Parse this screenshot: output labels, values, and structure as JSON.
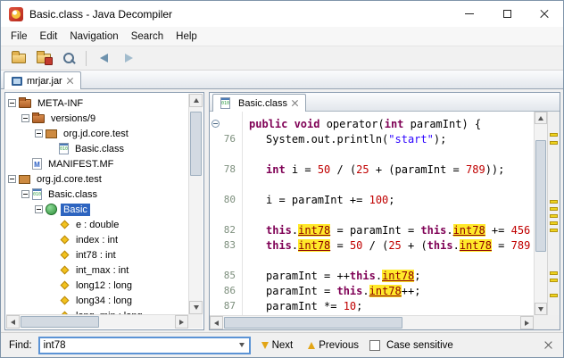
{
  "window": {
    "title": "Basic.class - Java Decompiler"
  },
  "menu": {
    "items": [
      "File",
      "Edit",
      "Navigation",
      "Search",
      "Help"
    ]
  },
  "toolbar": {
    "items": [
      {
        "name": "open-file-button",
        "icon": "folder-open"
      },
      {
        "name": "open-jar-button",
        "icon": "folder-jar"
      },
      {
        "name": "search-button",
        "icon": "search"
      },
      {
        "separator": true
      },
      {
        "name": "back-button",
        "icon": "arrow-left"
      },
      {
        "name": "forward-button",
        "icon": "arrow-right"
      }
    ]
  },
  "document_tabs": [
    {
      "label": "mrjar.jar",
      "icon": "jar",
      "selected": true
    }
  ],
  "tree": {
    "items": [
      {
        "label": "META-INF",
        "level": 0,
        "exp": "minus",
        "icon": "folder"
      },
      {
        "label": "versions/9",
        "level": 1,
        "exp": "minus",
        "icon": "folder"
      },
      {
        "label": "org.jd.core.test",
        "level": 2,
        "exp": "minus",
        "icon": "package"
      },
      {
        "label": "Basic.class",
        "level": 3,
        "exp": "none",
        "icon": "classfile"
      },
      {
        "label": "MANIFEST.MF",
        "level": 1,
        "exp": "none",
        "icon": "manifest"
      },
      {
        "label": "org.jd.core.test",
        "level": 0,
        "exp": "minus",
        "icon": "package"
      },
      {
        "label": "Basic.class",
        "level": 1,
        "exp": "minus",
        "icon": "classfile"
      },
      {
        "label": "Basic",
        "level": 2,
        "exp": "minus",
        "icon": "class",
        "selected": true
      },
      {
        "label": "e : double",
        "level": 3,
        "exp": "none",
        "icon": "field"
      },
      {
        "label": "index : int",
        "level": 3,
        "exp": "none",
        "icon": "field"
      },
      {
        "label": "int78 : int",
        "level": 3,
        "exp": "none",
        "icon": "field"
      },
      {
        "label": "int_max : int",
        "level": 3,
        "exp": "none",
        "icon": "field"
      },
      {
        "label": "long12 : long",
        "level": 3,
        "exp": "none",
        "icon": "field"
      },
      {
        "label": "long34 : long",
        "level": 3,
        "exp": "none",
        "icon": "field"
      },
      {
        "label": "long_min : long",
        "level": 3,
        "exp": "none",
        "icon": "field"
      }
    ]
  },
  "editor": {
    "tab": {
      "label": "Basic.class",
      "icon": "classfile"
    },
    "lines": [
      {
        "num": "",
        "fold": true,
        "indent": 1,
        "tokens": [
          [
            "kw",
            "public void "
          ],
          [
            "pl",
            "operator("
          ],
          [
            "kw",
            "int"
          ],
          [
            "pl",
            " paramInt) {"
          ]
        ]
      },
      {
        "num": "76",
        "fold": false,
        "indent": 2,
        "tokens": [
          [
            "pl",
            "System.out.println("
          ],
          [
            "str",
            "\"start\""
          ],
          [
            "pl",
            ");"
          ]
        ]
      },
      {
        "num": "",
        "fold": false,
        "indent": 0,
        "tokens": []
      },
      {
        "num": "78",
        "fold": false,
        "indent": 2,
        "tokens": [
          [
            "kw",
            "int"
          ],
          [
            "pl",
            " i = "
          ],
          [
            "num",
            "50"
          ],
          [
            "pl",
            " / ("
          ],
          [
            "num",
            "25"
          ],
          [
            "pl",
            " + (paramInt = "
          ],
          [
            "num",
            "789"
          ],
          [
            "pl",
            "));"
          ]
        ]
      },
      {
        "num": "",
        "fold": false,
        "indent": 0,
        "tokens": []
      },
      {
        "num": "80",
        "fold": false,
        "indent": 2,
        "tokens": [
          [
            "pl",
            "i = paramInt += "
          ],
          [
            "num",
            "100"
          ],
          [
            "pl",
            ";"
          ]
        ]
      },
      {
        "num": "",
        "fold": false,
        "indent": 0,
        "tokens": []
      },
      {
        "num": "82",
        "fold": false,
        "indent": 2,
        "tokens": [
          [
            "kw",
            "this"
          ],
          [
            "pl",
            "."
          ],
          [
            "fh",
            "int78"
          ],
          [
            "pl",
            " = paramInt = "
          ],
          [
            "kw",
            "this"
          ],
          [
            "pl",
            "."
          ],
          [
            "fh",
            "int78"
          ],
          [
            "pl",
            " += "
          ],
          [
            "num",
            "456"
          ]
        ]
      },
      {
        "num": "83",
        "fold": false,
        "indent": 2,
        "tokens": [
          [
            "kw",
            "this"
          ],
          [
            "pl",
            "."
          ],
          [
            "fh",
            "int78"
          ],
          [
            "pl",
            " = "
          ],
          [
            "num",
            "50"
          ],
          [
            "pl",
            " / ("
          ],
          [
            "num",
            "25"
          ],
          [
            "pl",
            " + ("
          ],
          [
            "kw",
            "this"
          ],
          [
            "pl",
            "."
          ],
          [
            "fh",
            "int78"
          ],
          [
            "pl",
            " = "
          ],
          [
            "num",
            "789"
          ]
        ]
      },
      {
        "num": "",
        "fold": false,
        "indent": 0,
        "tokens": []
      },
      {
        "num": "85",
        "fold": false,
        "indent": 2,
        "tokens": [
          [
            "pl",
            "paramInt = ++"
          ],
          [
            "kw",
            "this"
          ],
          [
            "pl",
            "."
          ],
          [
            "fh",
            "int78"
          ],
          [
            "pl",
            ";"
          ]
        ]
      },
      {
        "num": "86",
        "fold": false,
        "indent": 2,
        "tokens": [
          [
            "pl",
            "paramInt = "
          ],
          [
            "kw",
            "this"
          ],
          [
            "pl",
            "."
          ],
          [
            "fh",
            "int78"
          ],
          [
            "pl",
            "++;"
          ]
        ]
      },
      {
        "num": "87",
        "fold": false,
        "indent": 2,
        "tokens": [
          [
            "pl",
            "paramInt *= "
          ],
          [
            "num",
            "10"
          ],
          [
            "pl",
            ";"
          ]
        ]
      }
    ],
    "match_marks": [
      0.105,
      0.145,
      0.435,
      0.47,
      0.505,
      0.54,
      0.575,
      0.785,
      0.82,
      0.895
    ]
  },
  "find_bar": {
    "label": "Find:",
    "value": "int78",
    "next_label": "Next",
    "previous_label": "Previous",
    "case_label": "Case sensitive",
    "case_checked": false
  },
  "colors": {
    "selection": "#2e65c0",
    "keyword": "#7f0055",
    "string": "#2a00ff",
    "number": "#c00000",
    "field_link": "#8b0000",
    "search_highlight": "#ffe92a",
    "match_marker": "#efd41f",
    "line_number": "#7d8f7d"
  }
}
